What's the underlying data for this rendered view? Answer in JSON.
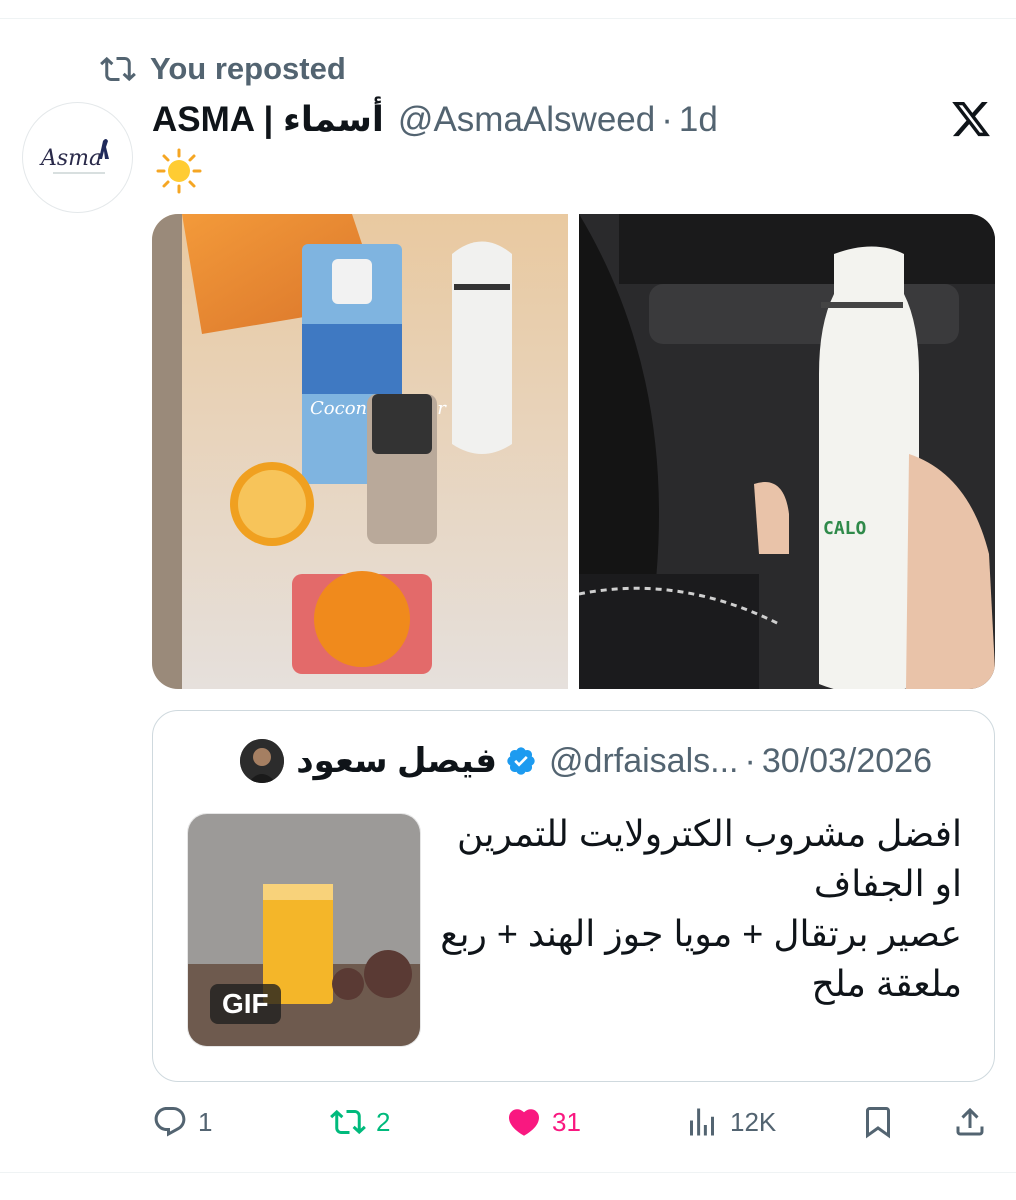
{
  "repost": {
    "label": "You reposted"
  },
  "tweet": {
    "author_name": "ASMA | أسماء",
    "handle": "@AsmaAlsweed",
    "separator": "·",
    "time": "1d",
    "body_emoji": "sun-emoji",
    "avatar_logo_text": "Asma"
  },
  "quote": {
    "author_name": "فيصل سعود",
    "handle": "@drfaisals...",
    "separator": "·",
    "date": "30/03/2026",
    "text_lines": [
      "افضل مشروب الكترولايت للتمرين",
      "او الجفاف",
      "عصير برتقال + مويا جوز الهند + ربع",
      "ملعقة ملح"
    ],
    "gif_label": "GIF"
  },
  "media": {
    "left_photo_text": "Coconut Water",
    "right_photo_text": "CALO"
  },
  "actions": {
    "replies": "1",
    "reposts": "2",
    "likes": "31",
    "views": "12K"
  },
  "colors": {
    "repost_green": "#00ba7c",
    "like_pink": "#f91880",
    "muted": "#536471",
    "verified_blue": "#1d9bf0"
  }
}
